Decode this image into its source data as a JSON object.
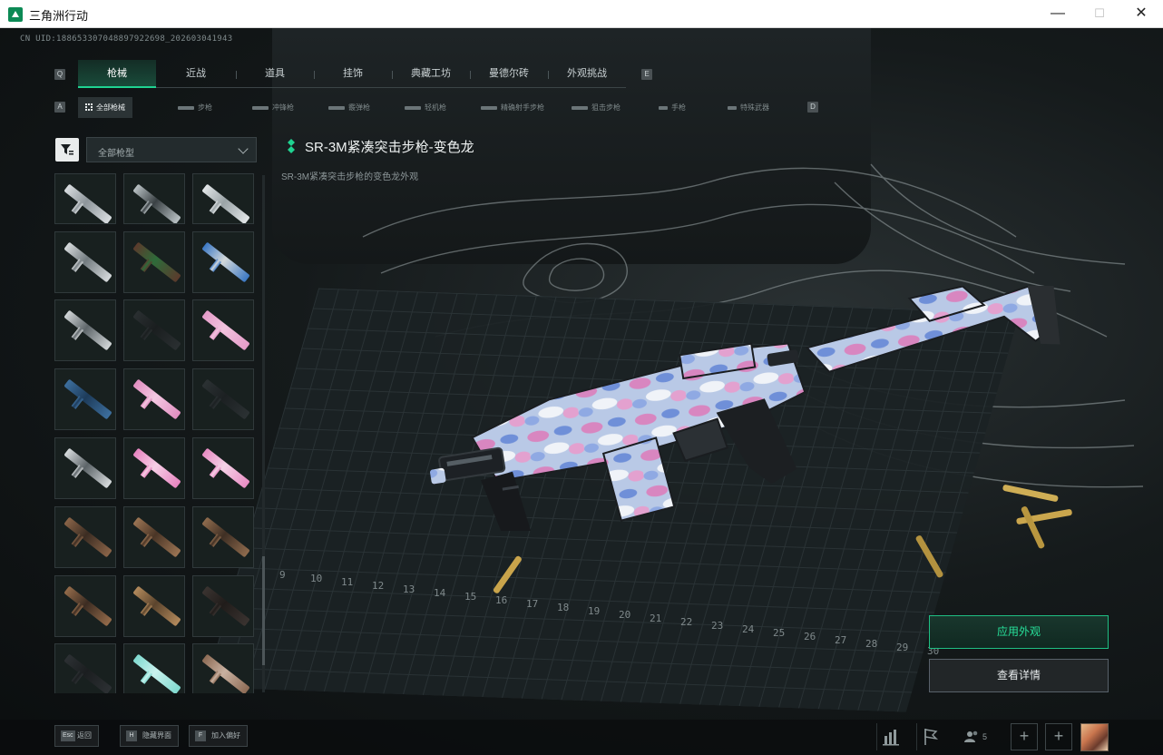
{
  "window": {
    "title": "三角洲行动",
    "controls": [
      "—",
      "☐",
      "✕"
    ]
  },
  "uid": "CN UID:188653307048897922698_20260304194З",
  "categories": {
    "prev_key": "Q",
    "next_key": "E",
    "items": [
      {
        "label": "枪械",
        "active": true
      },
      {
        "label": "近战",
        "active": false
      },
      {
        "label": "道具",
        "active": false
      },
      {
        "label": "挂饰",
        "active": false
      },
      {
        "label": "典藏工坊",
        "active": false
      },
      {
        "label": "曼德尔砖",
        "active": false
      },
      {
        "label": "外观挑战",
        "active": false
      }
    ]
  },
  "subcategories": {
    "prev_key": "A",
    "next_key": "D",
    "items": [
      {
        "label": "全部枪械",
        "active": true
      },
      {
        "label": "步枪",
        "active": false
      },
      {
        "label": "冲锋枪",
        "active": false
      },
      {
        "label": "霰弹枪",
        "active": false
      },
      {
        "label": "轻机枪",
        "active": false
      },
      {
        "label": "精确射手步枪",
        "active": false
      },
      {
        "label": "狙击步枪",
        "active": false
      },
      {
        "label": "手枪",
        "active": false
      },
      {
        "label": "特殊武器",
        "active": false
      }
    ]
  },
  "filter": {
    "icon": "filter-icon",
    "dropdown_value": "全部枪型"
  },
  "skins": [
    {
      "color": "#d9dde0",
      "accent": "#8d959a"
    },
    {
      "color": "#b9c1c4",
      "accent": "#3a4144"
    },
    {
      "color": "#e2e6e8",
      "accent": "#9aa3a6"
    },
    {
      "color": "#d6dadc",
      "accent": "#737c80"
    },
    {
      "color": "#5b3a2c",
      "accent": "#2e6b3a"
    },
    {
      "color": "#3b78c4",
      "accent": "#d3d8da"
    },
    {
      "color": "#d2d6d8",
      "accent": "#5e666a"
    },
    {
      "color": "#2a2f31",
      "accent": "#1a1e1f"
    },
    {
      "color": "#e49bc8",
      "accent": "#f2c3de"
    },
    {
      "color": "#3d6f9e",
      "accent": "#1d3b5a"
    },
    {
      "color": "#e18ec0",
      "accent": "#f4c8e2"
    },
    {
      "color": "#2b3133",
      "accent": "#1c2022"
    },
    {
      "color": "#d7dbdd",
      "accent": "#5c6468"
    },
    {
      "color": "#e784c0",
      "accent": "#f7cfe6"
    },
    {
      "color": "#e88cc3",
      "accent": "#f5d2e7"
    },
    {
      "color": "#8a6448",
      "accent": "#3b2c22"
    },
    {
      "color": "#9b7453",
      "accent": "#4a3526"
    },
    {
      "color": "#8f6b4d",
      "accent": "#3f2f24"
    },
    {
      "color": "#946b4a",
      "accent": "#3c2c22"
    },
    {
      "color": "#b38a5c",
      "accent": "#5b442d"
    },
    {
      "color": "#3a3330",
      "accent": "#201c1a"
    },
    {
      "color": "#2c3033",
      "accent": "#1b1e20"
    },
    {
      "color": "#7fd9cf",
      "accent": "#c9f2ee"
    },
    {
      "color": "#8d6b55",
      "accent": "#c9b1a1"
    }
  ],
  "item": {
    "name": "SR-3M紧凑突击步枪-变色龙",
    "description": "SR-3M紧凑突击步枪的变色龙外观",
    "rarity_color": "#1fd391"
  },
  "actions": {
    "apply_label": "应用外观",
    "details_label": "查看详情"
  },
  "bottom_hints": [
    {
      "key": "Esc",
      "label": "返回"
    },
    {
      "key": "H",
      "label": "隐藏界面"
    },
    {
      "key": "F",
      "label": "加入偏好"
    }
  ],
  "status": {
    "stats_icon": "bar-chart-icon",
    "flag_icon": "flag-icon",
    "friends_icon": "friends-icon",
    "player_count": "5",
    "add_label": "+"
  },
  "mat_ruler": [
    "9",
    "10",
    "11",
    "12",
    "13",
    "14",
    "15",
    "16",
    "17",
    "18",
    "19",
    "20",
    "21",
    "22",
    "23",
    "24",
    "25",
    "26",
    "27",
    "28",
    "29",
    "30"
  ]
}
